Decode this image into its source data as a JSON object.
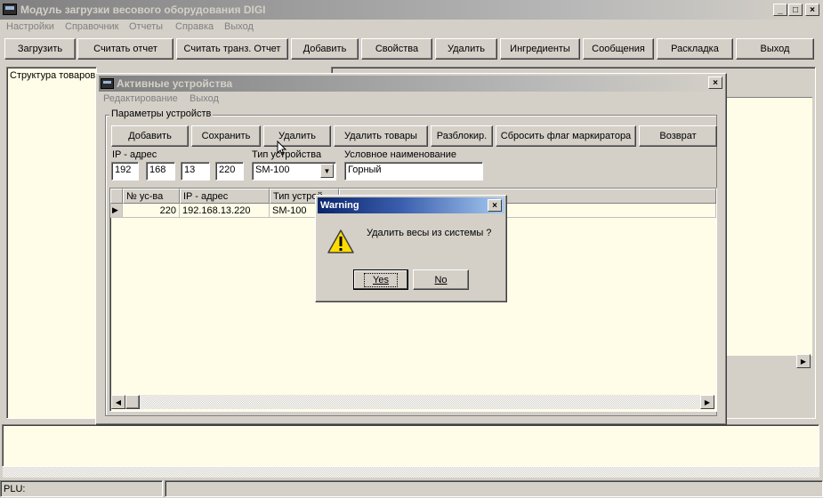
{
  "main_window": {
    "title": "Модуль загрузки весового оборудования DIGI",
    "menu": [
      "Настройки",
      "Справочник",
      "Отчеты",
      "Справка",
      "Выход"
    ],
    "toolbar": [
      "Загрузить",
      "Считать отчет",
      "Считать транз. Отчет",
      "Добавить",
      "Свойства",
      "Удалить",
      "Ингредиенты",
      "Сообщения",
      "Раскладка",
      "Выход"
    ],
    "left_panel_title": "Структура товаров",
    "status_label": "PLU:"
  },
  "devices_window": {
    "title": "Активные устройства",
    "menu": [
      "Редактирование",
      "Выход"
    ],
    "group_title": "Параметры устройств",
    "buttons": [
      "Добавить",
      "Сохранить",
      "Удалить",
      "Удалить товары",
      "Разблокир.",
      "Сбросить флаг маркиратора",
      "Возврат"
    ],
    "ip_label": "IP - адрес",
    "ip_octets": [
      "192",
      "168",
      "13",
      "220"
    ],
    "type_label": "Тип устройства",
    "type_value": "SM-100",
    "name_label": "Условное наименование",
    "name_value": "Горный",
    "table": {
      "headers": [
        "№ ус-ва",
        "IP - адрес",
        "Тип устрой"
      ],
      "rows": [
        {
          "num": "220",
          "ip": "192.168.13.220",
          "type": "SM-100"
        }
      ]
    }
  },
  "warning_dialog": {
    "title": "Warning",
    "message": "Удалить весы из системы ?",
    "yes": "Yes",
    "no": "No"
  },
  "colors": {
    "face": "#d4d0c8",
    "cream": "#fffde8",
    "active_title": "#0a246a",
    "inactive_title": "#808080"
  }
}
